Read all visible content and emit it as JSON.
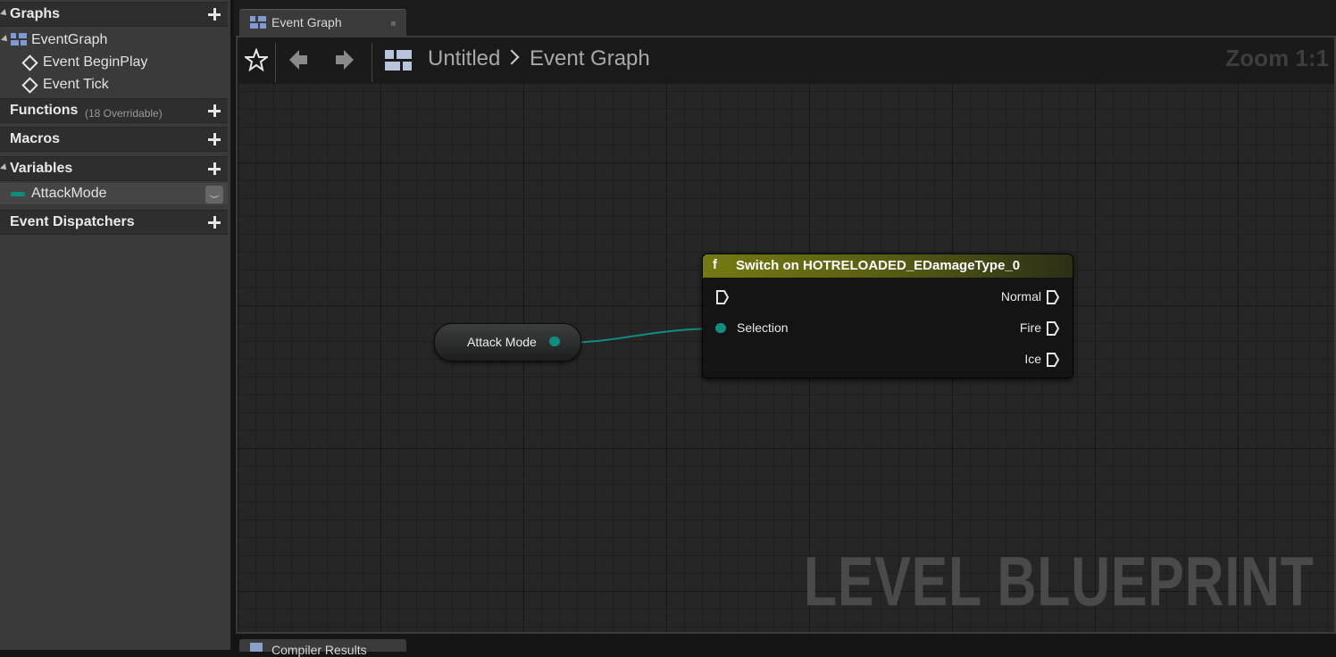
{
  "left_panel": {
    "graphs": {
      "label": "Graphs"
    },
    "event_graph": {
      "label": "EventGraph"
    },
    "events": [
      {
        "label": "Event BeginPlay"
      },
      {
        "label": "Event Tick"
      }
    ],
    "functions": {
      "label": "Functions",
      "sub": "(18 Overridable)"
    },
    "macros": {
      "label": "Macros"
    },
    "variables": {
      "label": "Variables"
    },
    "variable_items": [
      {
        "label": "AttackMode",
        "color": "#0e8e80"
      }
    ],
    "dispatchers": {
      "label": "Event Dispatchers"
    }
  },
  "tab": {
    "label": "Event Graph"
  },
  "toolbar": {
    "breadcrumb_root": "Untitled",
    "breadcrumb_current": "Event Graph",
    "zoom": "Zoom 1:1"
  },
  "graph": {
    "watermark": "LEVEL BLUEPRINT",
    "var_node": {
      "label": "Attack Mode",
      "pin_color": "#0e8e80"
    },
    "switch_node": {
      "title": "Switch on HOTRELOADED_EDamageType_0",
      "input_pin": "Selection",
      "outputs": [
        "Normal",
        "Fire",
        "Ice"
      ],
      "header_color": "#747a12"
    }
  },
  "bottom": {
    "tab_label": "Compiler Results"
  }
}
